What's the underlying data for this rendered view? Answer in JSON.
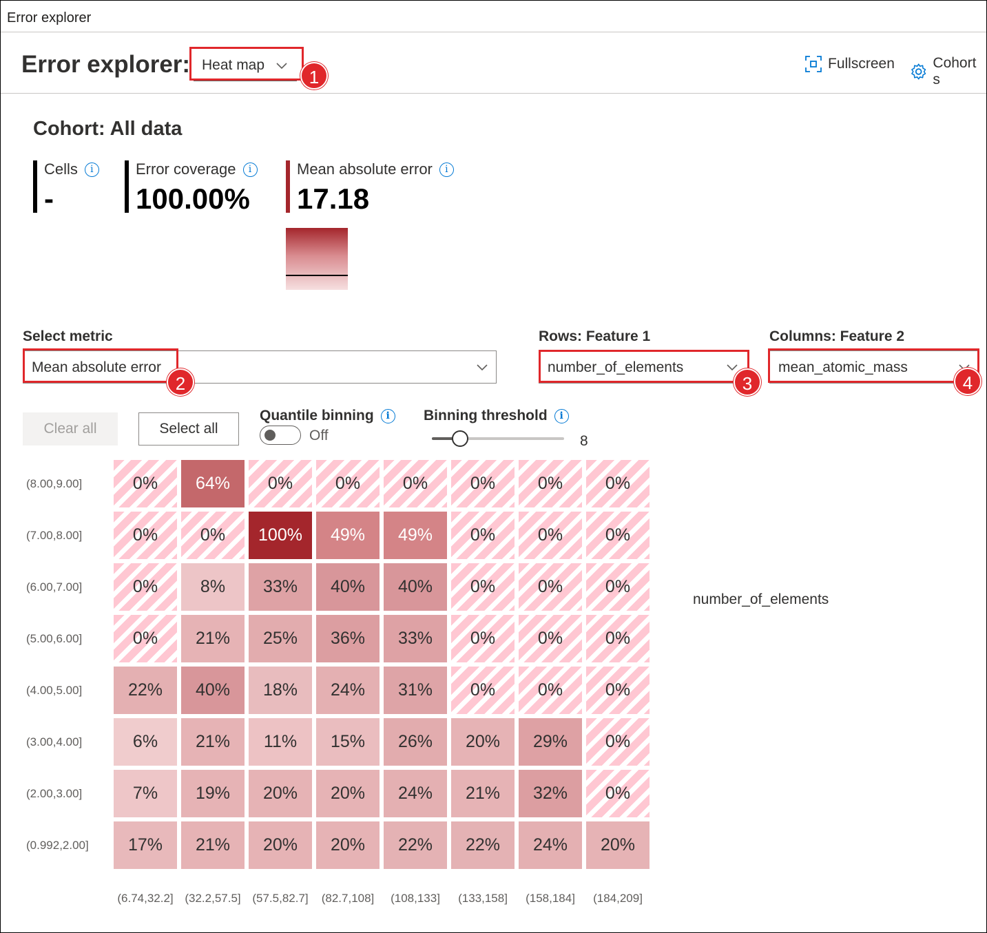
{
  "window": {
    "title": "Error explorer"
  },
  "header": {
    "title": "Error explorer:",
    "view_select": {
      "value": "Heat map"
    },
    "actions": {
      "fullscreen": "Fullscreen",
      "cohort_settings": "Cohort s"
    }
  },
  "callouts": [
    "1",
    "2",
    "3",
    "4"
  ],
  "cohort": {
    "title": "Cohort: All data",
    "metrics": [
      {
        "label": "Cells",
        "value": "-",
        "bar_color": "#000000"
      },
      {
        "label": "Error coverage",
        "value": "100.00%",
        "bar_color": "#000000"
      },
      {
        "label": "Mean absolute error",
        "value": "17.18",
        "bar_color": "#a4262c"
      }
    ]
  },
  "controls": {
    "metric": {
      "label": "Select metric",
      "value": "Mean absolute error"
    },
    "rows": {
      "label": "Rows: Feature 1",
      "value": "number_of_elements"
    },
    "columns": {
      "label": "Columns: Feature 2",
      "value": "mean_atomic_mass"
    },
    "clear_all": "Clear all",
    "select_all": "Select all",
    "quantile_binning": {
      "label": "Quantile binning",
      "state": "Off"
    },
    "binning_threshold": {
      "label": "Binning threshold",
      "value": "8",
      "min": 2,
      "max": 30
    }
  },
  "heatmap": {
    "row_feature": "number_of_elements",
    "row_labels": [
      "(8.00,9.00]",
      "(7.00,8.00]",
      "(6.00,7.00]",
      "(5.00,6.00]",
      "(4.00,5.00]",
      "(3.00,4.00]",
      "(2.00,3.00]",
      "(0.992,2.00]"
    ],
    "col_labels": [
      "(6.74,32.2]",
      "(32.2,57.5]",
      "(57.5,82.7]",
      "(82.7,108]",
      "(108,133]",
      "(133,158]",
      "(158,184]",
      "(184,209]"
    ],
    "cells": [
      [
        "0%",
        "64%",
        "0%",
        "0%",
        "0%",
        "0%",
        "0%",
        "0%"
      ],
      [
        "0%",
        "0%",
        "100%",
        "49%",
        "49%",
        "0%",
        "0%",
        "0%"
      ],
      [
        "0%",
        "8%",
        "33%",
        "40%",
        "40%",
        "0%",
        "0%",
        "0%"
      ],
      [
        "0%",
        "21%",
        "25%",
        "36%",
        "33%",
        "0%",
        "0%",
        "0%"
      ],
      [
        "22%",
        "40%",
        "18%",
        "24%",
        "31%",
        "0%",
        "0%",
        "0%"
      ],
      [
        "6%",
        "21%",
        "11%",
        "15%",
        "26%",
        "20%",
        "29%",
        "0%"
      ],
      [
        "7%",
        "19%",
        "20%",
        "20%",
        "24%",
        "21%",
        "32%",
        "0%"
      ],
      [
        "17%",
        "21%",
        "20%",
        "20%",
        "22%",
        "22%",
        "24%",
        "20%"
      ]
    ],
    "hatched": [
      [
        true,
        false,
        true,
        true,
        true,
        true,
        true,
        true
      ],
      [
        true,
        true,
        false,
        false,
        false,
        true,
        true,
        true
      ],
      [
        true,
        false,
        false,
        false,
        false,
        true,
        true,
        true
      ],
      [
        true,
        false,
        false,
        false,
        false,
        true,
        true,
        true
      ],
      [
        false,
        false,
        false,
        false,
        false,
        true,
        true,
        true
      ],
      [
        false,
        false,
        false,
        false,
        false,
        false,
        false,
        true
      ],
      [
        false,
        false,
        false,
        false,
        false,
        false,
        false,
        true
      ],
      [
        false,
        false,
        false,
        false,
        false,
        false,
        false,
        false
      ]
    ],
    "fills": [
      [
        null,
        "#c4686b",
        null,
        null,
        null,
        null,
        null,
        null
      ],
      [
        null,
        null,
        "#a4262c",
        "#d48487",
        "#d48487",
        null,
        null,
        null
      ],
      [
        null,
        "#edc5c7",
        "#dea2a5",
        "#d8969a",
        "#d8969a",
        null,
        null,
        null
      ],
      [
        null,
        "#e6b3b5",
        "#e2acae",
        "#dc9ea1",
        "#dea2a5",
        null,
        null,
        null
      ],
      [
        "#e4b0b2",
        "#d8969a",
        "#e8bcbe",
        "#e4b0b2",
        "#dea4a7",
        null,
        null,
        null
      ],
      [
        "#f0cccd",
        "#e6b3b5",
        "#edc2c4",
        "#eabdbf",
        "#e2acae",
        "#e6b3b5",
        "#dea1a4",
        null
      ],
      [
        "#eec6c8",
        "#e6b3b5",
        "#e6b3b5",
        "#e6b3b5",
        "#e4b0b2",
        "#e6b3b5",
        "#dc9ea1",
        null
      ],
      [
        "#e8b9bb",
        "#e6b3b5",
        "#e6b3b5",
        "#e6b3b5",
        "#e4b2b4",
        "#e4b2b4",
        "#e4b0b2",
        "#e6b3b5"
      ]
    ]
  }
}
